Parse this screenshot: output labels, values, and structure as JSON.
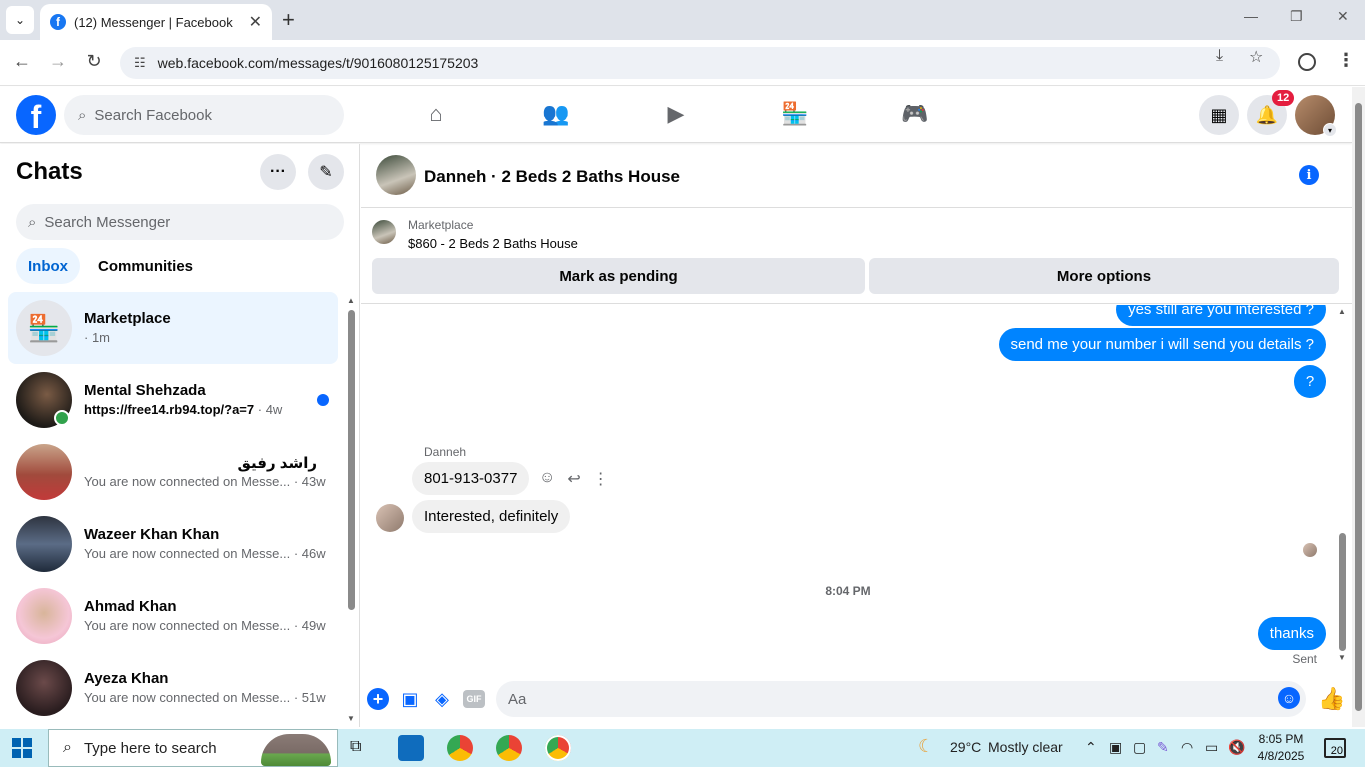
{
  "browser": {
    "tab_title": "(12) Messenger | Facebook",
    "tab_close": "✕",
    "new_tab": "+",
    "url": "web.facebook.com/messages/t/9016080125175203"
  },
  "fb_header": {
    "logo_letter": "f",
    "search_placeholder": "Search Facebook",
    "notification_count": "12"
  },
  "sidebar": {
    "title": "Chats",
    "search_placeholder": "Search Messenger",
    "filters": [
      "Inbox",
      "Communities"
    ],
    "chats": [
      {
        "name": "Marketplace",
        "preview": "",
        "time": "· 1m",
        "selected": true
      },
      {
        "name": "Mental Shehzada",
        "preview": "https://free14.rb94.top/?a=7",
        "time": " · 4w",
        "unread": true,
        "online": true
      },
      {
        "name": "راشد رفیق",
        "preview": "You are now connected on Messe...",
        "time": " · 43w"
      },
      {
        "name": "Wazeer Khan Khan",
        "preview": "You are now connected on Messe...",
        "time": " · 46w"
      },
      {
        "name": "Ahmad Khan",
        "preview": "You are now connected on Messe...",
        "time": " · 49w"
      },
      {
        "name": "Ayeza Khan",
        "preview": "You are now connected on Messe...",
        "time": " · 51w"
      }
    ]
  },
  "conversation": {
    "title": "Danneh · 2 Beds 2 Baths House",
    "listing": {
      "label": "Marketplace",
      "title": "$860 - 2 Beds 2 Baths House",
      "buttons": [
        "Mark as pending",
        "More options"
      ]
    },
    "messages": {
      "out_1": "yes still are you interested ?",
      "out_2": "send me your number i will send you details ?",
      "out_3": "?",
      "sender": "Danneh",
      "in_1": "801-913-0377",
      "in_2": "Interested, definitely",
      "timestamp": "8:04 PM",
      "out_4": "thanks",
      "status": "Sent"
    },
    "composer_placeholder": "Aa",
    "gif_label": "GIF"
  },
  "taskbar": {
    "search_placeholder": "Type here to search",
    "weather_temp": "29°C",
    "weather_text": "Mostly clear",
    "time": "8:05 PM",
    "date": "4/8/2025",
    "notification_count": "20"
  }
}
